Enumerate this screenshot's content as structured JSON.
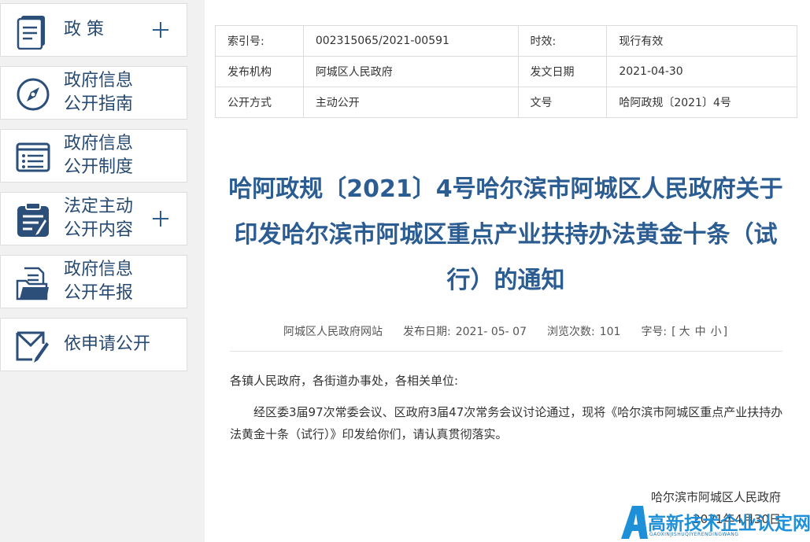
{
  "sidebar": {
    "items": [
      {
        "label": "政  策",
        "icon": "document-icon",
        "expand": true
      },
      {
        "label": "政府信息\n公开指南",
        "icon": "compass-icon",
        "expand": false
      },
      {
        "label": "政府信息\n公开制度",
        "icon": "list-icon",
        "expand": false
      },
      {
        "label": "法定主动\n公开内容",
        "icon": "clipboard-icon",
        "expand": true
      },
      {
        "label": "政府信息\n公开年报",
        "icon": "folder-icon",
        "expand": false
      },
      {
        "label": "依申请公开",
        "icon": "envelope-pen-icon",
        "expand": false
      }
    ]
  },
  "meta": {
    "index_label": "索引号:",
    "index_value": "002315065/2021-00591",
    "validity_label": "时效:",
    "validity_value": "现行有效",
    "issuer_label": "发布机构",
    "issuer_value": "阿城区人民政府",
    "date_label": "发文日期",
    "date_value": "2021-04-30",
    "method_label": "公开方式",
    "method_value": "主动公开",
    "docno_label": "文号",
    "docno_value": "哈阿政规〔2021〕4号"
  },
  "article": {
    "title": "哈阿政规〔2021〕4号哈尔滨市阿城区人民政府关于印发哈尔滨市阿城区重点产业扶持办法黄金十条（试行）的通知",
    "source": "阿城区人民政府网站",
    "publish_label": "发布日期:",
    "publish_date": "2021- 05- 07",
    "views_label": "浏览次数:",
    "views": "101",
    "fontsize_label": "字号:",
    "fontsize_open": "[",
    "font_large": "大",
    "font_medium": "中",
    "font_small": "小",
    "fontsize_close": "]",
    "salutation": "各镇人民政府，各街道办事处，各相关单位:",
    "paragraph": "经区委3届97次常委会议、区政府3届47次常务会议讨论通过，现将《哈尔滨市阿城区重点产业扶持办法黄金十条（试行）》印发给你们，请认真贯彻落实。",
    "signature": "哈尔滨市阿城区人民政府",
    "sign_date": "2021年4月30日"
  },
  "watermark": {
    "main": "高新技术企业认定网",
    "sub": "GAOXINJISHUQIYERENDINGWANG"
  },
  "colors": {
    "title": "#2b5c92",
    "sidebar_text": "#274a72",
    "watermark": "#1e90d8"
  }
}
